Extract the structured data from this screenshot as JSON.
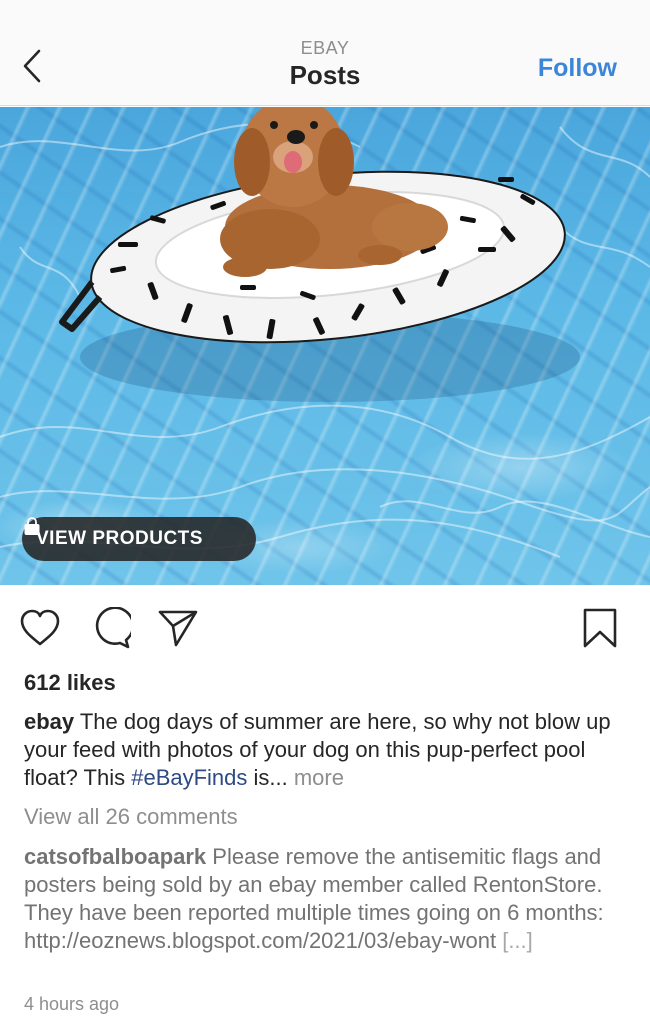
{
  "header": {
    "subtitle": "EBAY",
    "title": "Posts",
    "follow_label": "Follow"
  },
  "post": {
    "view_products_label": "VIEW PRODUCTS",
    "likes": "612 likes",
    "caption": {
      "username": "ebay",
      "text_before_tag": " The dog days of summer are here, so why not blow up your feed with photos of your dog on this pup-perfect pool float? This ",
      "hashtag": "#eBayFinds",
      "text_after_tag": " is... ",
      "more_label": "more"
    },
    "view_comments_label": "View all 26 comments",
    "comment": {
      "username": "catsofbalboapark",
      "text": " Please remove the antisemitic flags and posters being sold by an ebay member called RentonStore. They have been reported multiple times going on 6 months: http://",
      "link_text": "eoznews.blogspot.com/2021/03/ebay-wont",
      "truncation": " [...]"
    },
    "timestamp": "4 hours ago"
  },
  "icons": {
    "back": "chevron-left-icon",
    "like": "heart-icon",
    "comment": "comment-bubble-icon",
    "share": "paper-plane-icon",
    "save": "bookmark-icon",
    "bag": "shopping-bag-icon"
  },
  "colors": {
    "follow": "#3d85d8",
    "hashtag": "#2c4a83",
    "muted": "#8e8e8e",
    "pill_bg": "#262626"
  }
}
